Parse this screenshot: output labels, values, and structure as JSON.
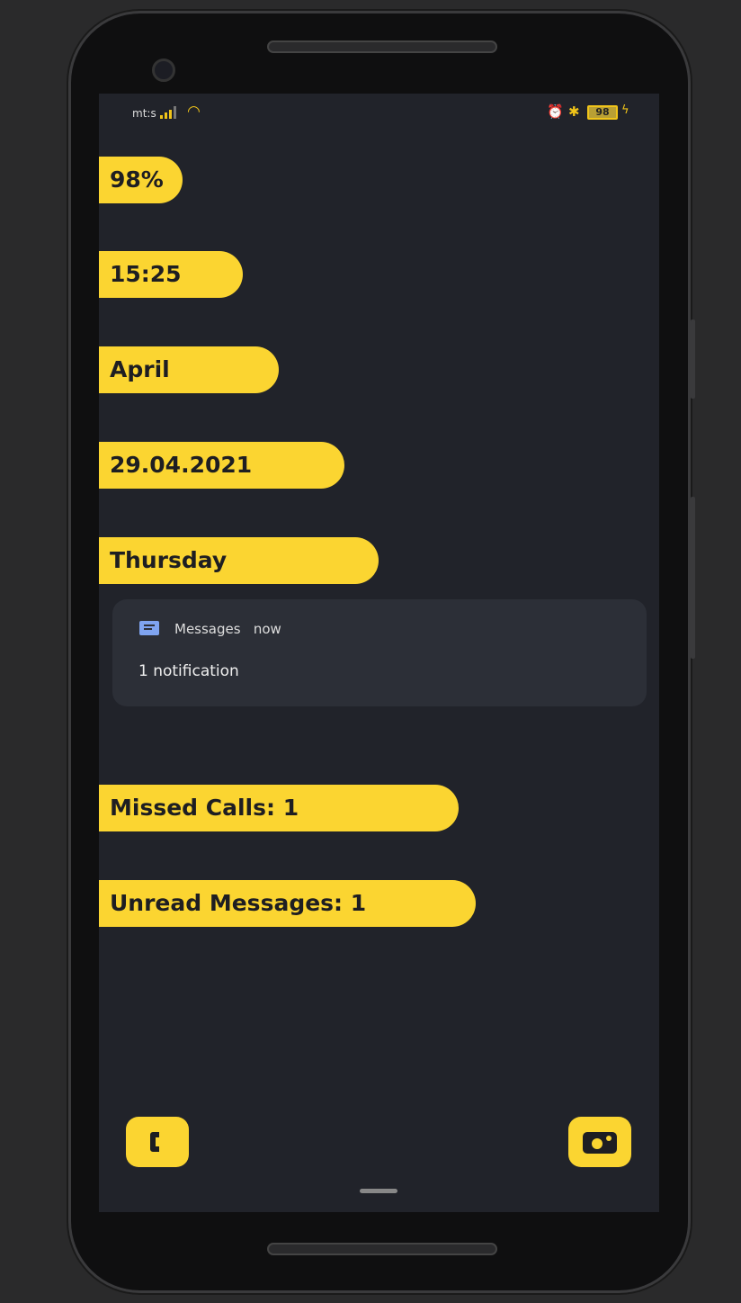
{
  "status_bar": {
    "carrier": "mt:s",
    "battery": "98",
    "icons": [
      "signal-icon",
      "wifi-icon",
      "alarm-icon",
      "bluetooth-icon",
      "battery-icon",
      "charging-icon"
    ]
  },
  "widgets": {
    "battery": "98%",
    "time": "15:25",
    "month": "April",
    "date": "29.04.2021",
    "weekday": "Thursday",
    "missed_calls": "Missed Calls: 1",
    "unread_messages": "Unread Messages: 1"
  },
  "notification": {
    "app": "Messages",
    "time": "now",
    "text": "1 notification"
  },
  "colors": {
    "accent": "#fbd531",
    "background": "#21232a",
    "card": "#2c2f37",
    "messages_icon": "#7fa4f0"
  },
  "shortcuts": [
    "phone-icon",
    "camera-icon"
  ]
}
